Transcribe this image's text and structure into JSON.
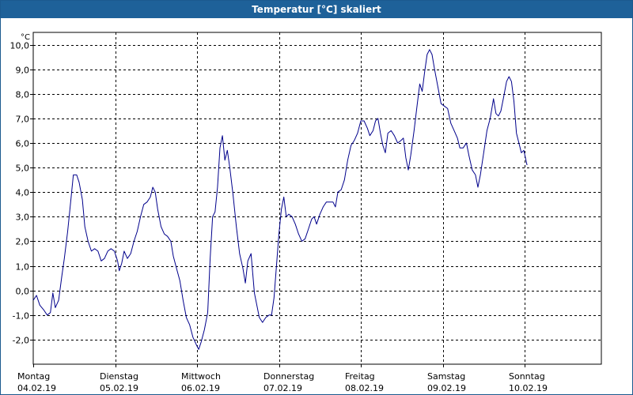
{
  "window": {
    "title": "Temperatur [°C] skaliert"
  },
  "chart_data": {
    "type": "line",
    "title": "Temperatur [°C] skaliert",
    "ylabel": "°C",
    "ylim": [
      -3.0,
      10.5
    ],
    "yticks": [
      "10,0",
      "9,0",
      "8,0",
      "7,0",
      "6,0",
      "5,0",
      "4,0",
      "3,0",
      "2,0",
      "1,0",
      "0,0",
      "-1,0",
      "-2,0"
    ],
    "ytick_values": [
      10,
      9,
      8,
      7,
      6,
      5,
      4,
      3,
      2,
      1,
      0,
      -1,
      -2
    ],
    "xlim": [
      0,
      7.0
    ],
    "x_unit": "days",
    "grid": true,
    "days": [
      {
        "weekday": "Montag",
        "date": "04.02.19"
      },
      {
        "weekday": "Dienstag",
        "date": "05.02.19"
      },
      {
        "weekday": "Mittwoch",
        "date": "06.02.19"
      },
      {
        "weekday": "Donnerstag",
        "date": "07.02.19"
      },
      {
        "weekday": "Freitag",
        "date": "08.02.19"
      },
      {
        "weekday": "Samstag",
        "date": "09.02.19"
      },
      {
        "weekday": "Sonntag",
        "date": "10.02.19"
      }
    ],
    "series": [
      {
        "color": "#00008b",
        "points": [
          [
            0.0,
            -0.4
          ],
          [
            0.04,
            -0.2
          ],
          [
            0.08,
            -0.6
          ],
          [
            0.13,
            -0.8
          ],
          [
            0.17,
            -1.0
          ],
          [
            0.21,
            -0.9
          ],
          [
            0.24,
            -0.1
          ],
          [
            0.27,
            -0.7
          ],
          [
            0.31,
            -0.4
          ],
          [
            0.35,
            0.6
          ],
          [
            0.38,
            1.3
          ],
          [
            0.42,
            2.4
          ],
          [
            0.46,
            3.7
          ],
          [
            0.49,
            4.7
          ],
          [
            0.53,
            4.7
          ],
          [
            0.56,
            4.4
          ],
          [
            0.6,
            3.7
          ],
          [
            0.63,
            2.6
          ],
          [
            0.67,
            2.0
          ],
          [
            0.71,
            1.6
          ],
          [
            0.75,
            1.7
          ],
          [
            0.79,
            1.6
          ],
          [
            0.83,
            1.2
          ],
          [
            0.87,
            1.3
          ],
          [
            0.91,
            1.6
          ],
          [
            0.95,
            1.7
          ],
          [
            0.99,
            1.6
          ],
          [
            1.03,
            1.2
          ],
          [
            1.05,
            0.8
          ],
          [
            1.08,
            1.1
          ],
          [
            1.11,
            1.6
          ],
          [
            1.15,
            1.3
          ],
          [
            1.19,
            1.5
          ],
          [
            1.23,
            2.0
          ],
          [
            1.27,
            2.4
          ],
          [
            1.31,
            3.0
          ],
          [
            1.35,
            3.5
          ],
          [
            1.39,
            3.6
          ],
          [
            1.43,
            3.8
          ],
          [
            1.46,
            4.2
          ],
          [
            1.49,
            4.0
          ],
          [
            1.52,
            3.3
          ],
          [
            1.56,
            2.6
          ],
          [
            1.6,
            2.3
          ],
          [
            1.64,
            2.2
          ],
          [
            1.68,
            2.0
          ],
          [
            1.71,
            1.4
          ],
          [
            1.75,
            0.9
          ],
          [
            1.79,
            0.4
          ],
          [
            1.83,
            -0.4
          ],
          [
            1.87,
            -1.1
          ],
          [
            1.91,
            -1.4
          ],
          [
            1.95,
            -1.9
          ],
          [
            1.99,
            -2.2
          ],
          [
            2.02,
            -2.4
          ],
          [
            2.05,
            -2.1
          ],
          [
            2.09,
            -1.6
          ],
          [
            2.13,
            -0.9
          ],
          [
            2.16,
            1.3
          ],
          [
            2.19,
            3.0
          ],
          [
            2.22,
            3.2
          ],
          [
            2.25,
            4.2
          ],
          [
            2.28,
            5.8
          ],
          [
            2.31,
            6.3
          ],
          [
            2.34,
            5.3
          ],
          [
            2.37,
            5.7
          ],
          [
            2.4,
            5.0
          ],
          [
            2.44,
            3.9
          ],
          [
            2.48,
            2.6
          ],
          [
            2.52,
            1.5
          ],
          [
            2.56,
            0.9
          ],
          [
            2.59,
            0.3
          ],
          [
            2.62,
            1.2
          ],
          [
            2.66,
            1.5
          ],
          [
            2.68,
            0.7
          ],
          [
            2.7,
            -0.1
          ],
          [
            2.73,
            -0.6
          ],
          [
            2.76,
            -1.1
          ],
          [
            2.8,
            -1.3
          ],
          [
            2.84,
            -1.1
          ],
          [
            2.88,
            -1.0
          ],
          [
            2.91,
            -1.0
          ],
          [
            2.94,
            -0.3
          ],
          [
            2.97,
            1.0
          ],
          [
            3.0,
            2.3
          ],
          [
            3.03,
            3.3
          ],
          [
            3.06,
            3.8
          ],
          [
            3.09,
            3.0
          ],
          [
            3.12,
            3.1
          ],
          [
            3.16,
            3.0
          ],
          [
            3.2,
            2.7
          ],
          [
            3.24,
            2.3
          ],
          [
            3.28,
            2.0
          ],
          [
            3.32,
            2.1
          ],
          [
            3.36,
            2.5
          ],
          [
            3.4,
            2.9
          ],
          [
            3.43,
            3.0
          ],
          [
            3.46,
            2.7
          ],
          [
            3.5,
            3.1
          ],
          [
            3.54,
            3.4
          ],
          [
            3.58,
            3.6
          ],
          [
            3.62,
            3.6
          ],
          [
            3.66,
            3.6
          ],
          [
            3.69,
            3.4
          ],
          [
            3.72,
            4.0
          ],
          [
            3.76,
            4.1
          ],
          [
            3.8,
            4.5
          ],
          [
            3.84,
            5.3
          ],
          [
            3.88,
            5.9
          ],
          [
            3.92,
            6.1
          ],
          [
            3.96,
            6.4
          ],
          [
            4.0,
            6.9
          ],
          [
            4.04,
            6.9
          ],
          [
            4.08,
            6.6
          ],
          [
            4.11,
            6.3
          ],
          [
            4.15,
            6.5
          ],
          [
            4.18,
            6.9
          ],
          [
            4.21,
            7.0
          ],
          [
            4.24,
            6.4
          ],
          [
            4.27,
            5.9
          ],
          [
            4.3,
            5.6
          ],
          [
            4.33,
            6.4
          ],
          [
            4.37,
            6.5
          ],
          [
            4.41,
            6.3
          ],
          [
            4.45,
            6.0
          ],
          [
            4.49,
            6.1
          ],
          [
            4.52,
            6.2
          ],
          [
            4.55,
            5.4
          ],
          [
            4.58,
            4.9
          ],
          [
            4.61,
            5.5
          ],
          [
            4.65,
            6.5
          ],
          [
            4.69,
            7.6
          ],
          [
            4.72,
            8.4
          ],
          [
            4.75,
            8.1
          ],
          [
            4.78,
            8.9
          ],
          [
            4.81,
            9.6
          ],
          [
            4.84,
            9.8
          ],
          [
            4.87,
            9.6
          ],
          [
            4.9,
            9.0
          ],
          [
            4.94,
            8.3
          ],
          [
            4.98,
            7.6
          ],
          [
            5.02,
            7.5
          ],
          [
            5.06,
            7.4
          ],
          [
            5.1,
            6.8
          ],
          [
            5.14,
            6.5
          ],
          [
            5.18,
            6.2
          ],
          [
            5.21,
            5.8
          ],
          [
            5.25,
            5.8
          ],
          [
            5.29,
            6.0
          ],
          [
            5.32,
            5.5
          ],
          [
            5.36,
            4.9
          ],
          [
            5.4,
            4.7
          ],
          [
            5.43,
            4.2
          ],
          [
            5.46,
            4.7
          ],
          [
            5.5,
            5.6
          ],
          [
            5.54,
            6.5
          ],
          [
            5.58,
            7.0
          ],
          [
            5.62,
            7.8
          ],
          [
            5.65,
            7.2
          ],
          [
            5.68,
            7.1
          ],
          [
            5.71,
            7.3
          ],
          [
            5.74,
            7.8
          ],
          [
            5.78,
            8.5
          ],
          [
            5.81,
            8.7
          ],
          [
            5.84,
            8.5
          ],
          [
            5.87,
            7.7
          ],
          [
            5.9,
            6.4
          ],
          [
            5.93,
            6.0
          ],
          [
            5.96,
            5.6
          ],
          [
            5.99,
            5.7
          ],
          [
            6.03,
            5.1
          ]
        ]
      }
    ]
  }
}
